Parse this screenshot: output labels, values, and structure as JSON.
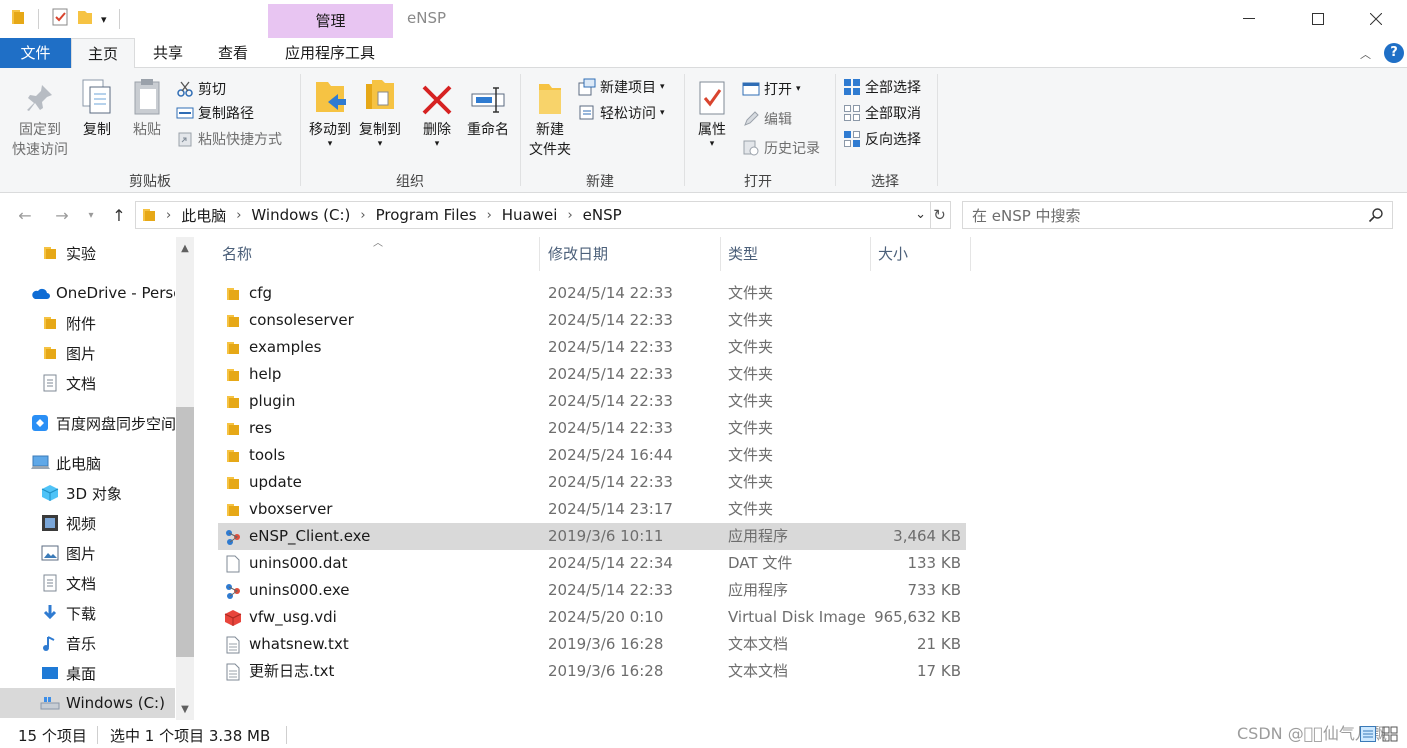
{
  "window": {
    "title": "eNSP",
    "context_tab": "管理",
    "context_tab_color": "#e8c5f2"
  },
  "tabs": {
    "file": "文件",
    "home": "主页",
    "share": "共享",
    "view": "查看",
    "app_tools": "应用程序工具",
    "file_tab_color": "#1f6fc6"
  },
  "ribbon": {
    "clipboard": {
      "label": "剪贴板",
      "pin": "固定到",
      "pin2": "快速访问",
      "copy": "复制",
      "paste": "粘贴",
      "cut": "剪切",
      "copy_path": "复制路径",
      "paste_shortcut": "粘贴快捷方式"
    },
    "organize": {
      "label": "组织",
      "move_to": "移动到",
      "copy_to": "复制到",
      "delete": "删除",
      "rename": "重命名"
    },
    "new": {
      "label": "新建",
      "new_folder": "新建",
      "new_folder2": "文件夹",
      "new_item": "新建项目",
      "easy_access": "轻松访问"
    },
    "open": {
      "label": "打开",
      "properties": "属性",
      "open": "打开",
      "edit": "编辑",
      "history": "历史记录"
    },
    "select": {
      "label": "选择",
      "select_all": "全部选择",
      "select_none": "全部取消",
      "invert": "反向选择"
    }
  },
  "address": {
    "crumbs": [
      "此电脑",
      "Windows (C:)",
      "Program Files",
      "Huawei",
      "eNSP"
    ],
    "search_placeholder": "在 eNSP 中搜索"
  },
  "nav": {
    "items": [
      {
        "label": "实验",
        "icon": "folder-icon"
      },
      {
        "label": "OneDrive - Perso",
        "icon": "cloud-icon"
      },
      {
        "label": "附件",
        "icon": "folder-icon"
      },
      {
        "label": "图片",
        "icon": "folder-icon"
      },
      {
        "label": "文档",
        "icon": "document-icon"
      },
      {
        "label": "百度网盘同步空间",
        "icon": "baidu-icon"
      },
      {
        "label": "此电脑",
        "icon": "computer-icon"
      },
      {
        "label": "3D 对象",
        "icon": "cube-icon"
      },
      {
        "label": "视频",
        "icon": "video-icon"
      },
      {
        "label": "图片",
        "icon": "picture-icon"
      },
      {
        "label": "文档",
        "icon": "document-icon"
      },
      {
        "label": "下载",
        "icon": "download-icon"
      },
      {
        "label": "音乐",
        "icon": "music-icon"
      },
      {
        "label": "桌面",
        "icon": "desktop-icon"
      },
      {
        "label": "Windows (C:)",
        "icon": "drive-icon"
      }
    ]
  },
  "columns": {
    "name": "名称",
    "date": "修改日期",
    "type": "类型",
    "size": "大小"
  },
  "files": [
    {
      "name": "cfg",
      "date": "2024/5/14 22:33",
      "type": "文件夹",
      "size": "",
      "icon": "folder-icon"
    },
    {
      "name": "consoleserver",
      "date": "2024/5/14 22:33",
      "type": "文件夹",
      "size": "",
      "icon": "folder-icon"
    },
    {
      "name": "examples",
      "date": "2024/5/14 22:33",
      "type": "文件夹",
      "size": "",
      "icon": "folder-icon"
    },
    {
      "name": "help",
      "date": "2024/5/14 22:33",
      "type": "文件夹",
      "size": "",
      "icon": "folder-icon"
    },
    {
      "name": "plugin",
      "date": "2024/5/14 22:33",
      "type": "文件夹",
      "size": "",
      "icon": "folder-icon"
    },
    {
      "name": "res",
      "date": "2024/5/14 22:33",
      "type": "文件夹",
      "size": "",
      "icon": "folder-icon"
    },
    {
      "name": "tools",
      "date": "2024/5/24 16:44",
      "type": "文件夹",
      "size": "",
      "icon": "folder-icon"
    },
    {
      "name": "update",
      "date": "2024/5/14 22:33",
      "type": "文件夹",
      "size": "",
      "icon": "folder-icon"
    },
    {
      "name": "vboxserver",
      "date": "2024/5/14 23:17",
      "type": "文件夹",
      "size": "",
      "icon": "folder-icon"
    },
    {
      "name": "eNSP_Client.exe",
      "date": "2019/3/6 10:11",
      "type": "应用程序",
      "size": "3,464 KB",
      "icon": "app-icon",
      "selected": true
    },
    {
      "name": "unins000.dat",
      "date": "2024/5/14 22:34",
      "type": "DAT 文件",
      "size": "133 KB",
      "icon": "file-icon"
    },
    {
      "name": "unins000.exe",
      "date": "2024/5/14 22:33",
      "type": "应用程序",
      "size": "733 KB",
      "icon": "app-icon"
    },
    {
      "name": "vfw_usg.vdi",
      "date": "2024/5/20 0:10",
      "type": "Virtual Disk Image",
      "size": "965,632 KB",
      "icon": "vdi-icon"
    },
    {
      "name": "whatsnew.txt",
      "date": "2019/3/6 16:28",
      "type": "文本文档",
      "size": "21 KB",
      "icon": "text-file-icon"
    },
    {
      "name": "更新日志.txt",
      "date": "2019/3/6 16:28",
      "type": "文本文档",
      "size": "17 KB",
      "icon": "text-file-icon"
    }
  ],
  "status": {
    "count": "15 个项目",
    "selection": "选中 1 个项目 3.38 MB",
    "watermark": "CSDN @\u0000\u0000仙气儿飘"
  }
}
